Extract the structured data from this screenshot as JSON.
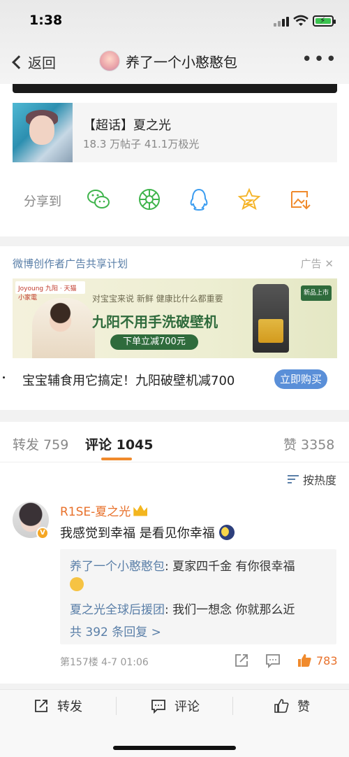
{
  "status": {
    "time": "1:38"
  },
  "nav": {
    "back_label": "返回",
    "title": "养了一个小憨憨包",
    "more": "•••"
  },
  "topic": {
    "title": "【超话】夏之光",
    "meta": "18.3 万帖子 41.1万极光"
  },
  "share": {
    "label": "分享到",
    "targets": [
      "wechat-icon",
      "moments-icon",
      "qq-icon",
      "qzone-icon",
      "save-image-icon"
    ]
  },
  "ad": {
    "header": "微博创作者广告共享计划",
    "tag": "广告",
    "banner_brand": "Joyoung 九阳 · 天猫小家電",
    "banner_line1": "对宝宝来说 新鲜 健康比什么都重要",
    "banner_line2": "九阳不用手洗破壁机",
    "banner_pill": "下单立减700元",
    "banner_new": "新品上市",
    "description": "宝宝辅食用它搞定！九阳破壁机减700",
    "button": "立即购买"
  },
  "tabs": {
    "repost": "转发 759",
    "comment": "评论 1045",
    "like": "赞 3358"
  },
  "sort_label": "按热度",
  "comment": {
    "author": "R1SE-夏之光",
    "text": "我感觉到幸福 是看见你幸福",
    "replies": [
      {
        "name": "养了一个小憨憨包",
        "text": ": 夏家四千金 有你很幸福"
      },
      {
        "name": "夏之光全球后援团",
        "text": ": 我们一想念 你就那么近"
      }
    ],
    "more_replies": "共 392 条回复 >",
    "meta": "第157楼  4-7 01:06",
    "likes": "783"
  },
  "bottom": {
    "repost": "转发",
    "comment": "评论",
    "like": "赞"
  },
  "colors": {
    "accent": "#f08a2c",
    "link": "#5a7fa8",
    "name_orange": "#e8712b",
    "button_blue": "#5a8fd8"
  }
}
